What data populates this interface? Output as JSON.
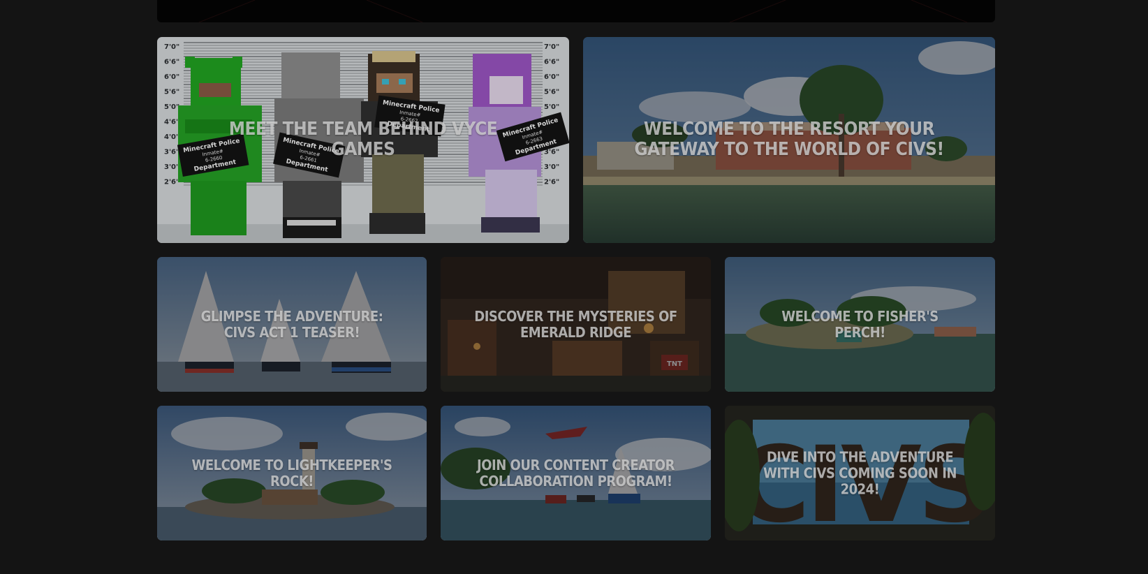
{
  "cards": {
    "team": {
      "title": "Meet the Team Behind Vyce Games"
    },
    "resort": {
      "title": "Welcome to The Resort Your Gateway to the World of Civs!"
    },
    "teaser": {
      "title": "Glimpse the Adventure: Civs Act 1 Teaser!"
    },
    "emerald": {
      "title": "Discover the Mysteries of Emerald Ridge"
    },
    "fisher": {
      "title": "Welcome to Fisher's Perch!"
    },
    "light": {
      "title": "Welcome to Lightkeeper's Rock!"
    },
    "creator": {
      "title": "Join Our Content Creator Collaboration Program!"
    },
    "civs": {
      "title": "Dive into the Adventure with Civs Coming Soon in 2024!"
    }
  },
  "team_image": {
    "height_marks": [
      "7'0\"",
      "6'6\"",
      "6'0\"",
      "5'6\"",
      "5'0\"",
      "4'6\"",
      "4'0\"",
      "3'6\"",
      "3'0\"",
      "2'6\""
    ],
    "placards": [
      {
        "line1": "Minecraft Police",
        "line2": "Inmate#",
        "line3": "6-2660",
        "line4": "Department"
      },
      {
        "line1": "Minecraft Police",
        "line2": "Inmate#",
        "line3": "6-2661",
        "line4": "Department"
      },
      {
        "line1": "Minecraft Police",
        "line2": "Inmate#",
        "line3": "6-2662",
        "line4": "Department"
      },
      {
        "line1": "Minecraft Police",
        "line2": "Inmate#",
        "line3": "6-2663",
        "line4": "Department"
      }
    ]
  },
  "emerald_image": {
    "crate_label": "TNT"
  },
  "civs_image": {
    "logo_text": "CIVS"
  },
  "colors": {
    "page_background": "#141414",
    "card_title": "#d6d6d6",
    "top_strip": "#030303"
  }
}
